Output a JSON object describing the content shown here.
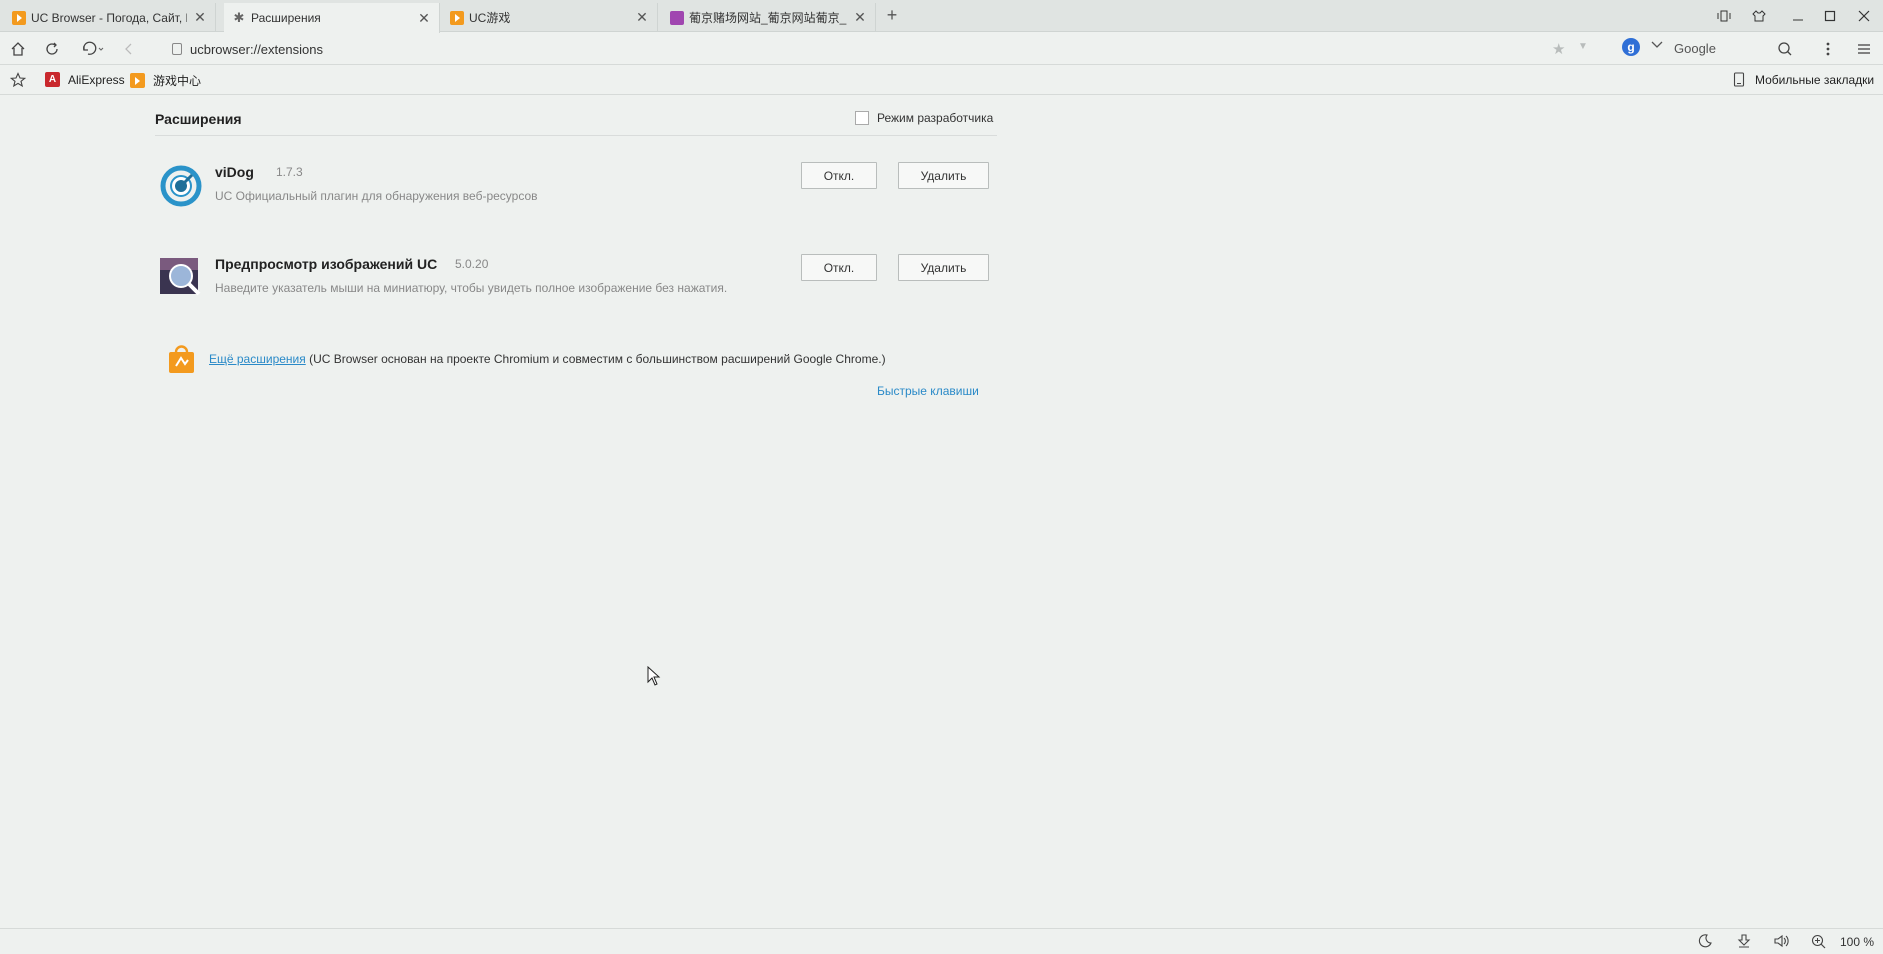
{
  "tabs": [
    {
      "title": "UC Browser - Погода, Сайт, Н",
      "icon": "uc-browser-icon",
      "close": "✕"
    },
    {
      "title": "Расширения",
      "icon": "extension-icon",
      "close": "✕"
    },
    {
      "title": "UC游戏",
      "icon": "uc-browser-icon",
      "close": "✕"
    },
    {
      "title": "葡京赌场网站_葡京网站葡京_",
      "icon": "site-favicon-icon",
      "close": "✕"
    }
  ],
  "new_tab": "+",
  "address": {
    "url": "ucbrowser://extensions"
  },
  "search": {
    "engine_letter": "g",
    "placeholder": "Google"
  },
  "bookmarks": {
    "items": [
      {
        "label": "AliExpress",
        "icon_letter": "A",
        "color": "#c9282d"
      },
      {
        "label": "游戏中心",
        "icon_letter": "",
        "color": "#f39a1e"
      }
    ],
    "mobile_label": "Мобильные закладки"
  },
  "page": {
    "title": "Расширения",
    "dev_mode_label": "Режим разработчика",
    "extensions": [
      {
        "name": "viDog",
        "version": "1.7.3",
        "description": "UC Официальный плагин для обнаружения веб-ресурсов",
        "disable_label": "Откл.",
        "remove_label": "Удалить"
      },
      {
        "name": "Предпросмотр изображений UC",
        "version": "5.0.20",
        "description": "Наведите указатель мыши на миниатюру, чтобы увидеть полное изображение без нажатия.",
        "disable_label": "Откл.",
        "remove_label": "Удалить"
      }
    ],
    "more_link": "Ещё расширения",
    "more_note": " (UC Browser основан на проекте Chromium и совместим с большинством расширений Google Chrome.)",
    "hotkeys_link": "Быстрые клавиши"
  },
  "status": {
    "zoom": "100 %"
  },
  "colors": {
    "accent": "#2a8ac8",
    "uc_orange": "#f39a1e"
  }
}
